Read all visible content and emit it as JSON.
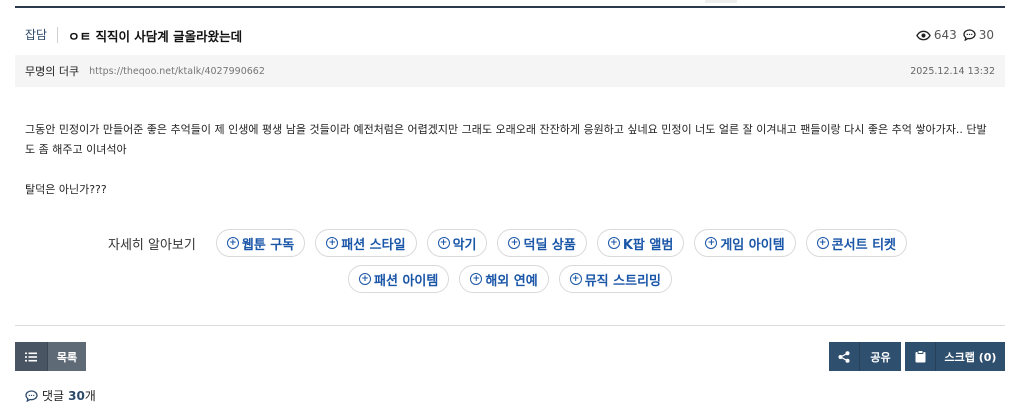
{
  "post": {
    "category": "잡담",
    "title": "ㅇㅌ 직직이 사담계 글올라왔는데",
    "views": "643",
    "comment_count": "30",
    "author": "무명의 더쿠",
    "url": "https://theqoo.net/ktalk/4027990662",
    "date": "2025.12.14 13:32",
    "body": [
      "그동안 민정이가 만들어준 좋은 추억들이 제 인생에 평생 남을 것들이라 예전처럼은 어렵겠지만 그래도 오래오래 잔잔하게 응원하고 싶네요 민정이 너도 얼른 잘 이겨내고 팬들이랑 다시 좋은 추억 쌓아가자.. 단발도 좀 해주고 이녀석아",
      "탈덕은 아닌가???"
    ]
  },
  "learn_more": {
    "label": "자세히 알아보기",
    "chips_row1": [
      "웹툰 구독",
      "패션 스타일",
      "악기",
      "덕딜 상품",
      "K팝 앨범",
      "게임 아이템",
      "콘서트 티켓"
    ],
    "chips_row2": [
      "패션 아이템",
      "해외 연예",
      "뮤직 스트리밍"
    ]
  },
  "actions": {
    "list_label": "목록",
    "share_label": "공유",
    "scrap_label": "스크랩 (0)"
  },
  "comments": {
    "label": "댓글",
    "count": "30",
    "suffix": "개"
  },
  "colors": {
    "accent": "#1a56a8",
    "navy": "#2f4f6f",
    "rule": "#2b3a4a"
  }
}
